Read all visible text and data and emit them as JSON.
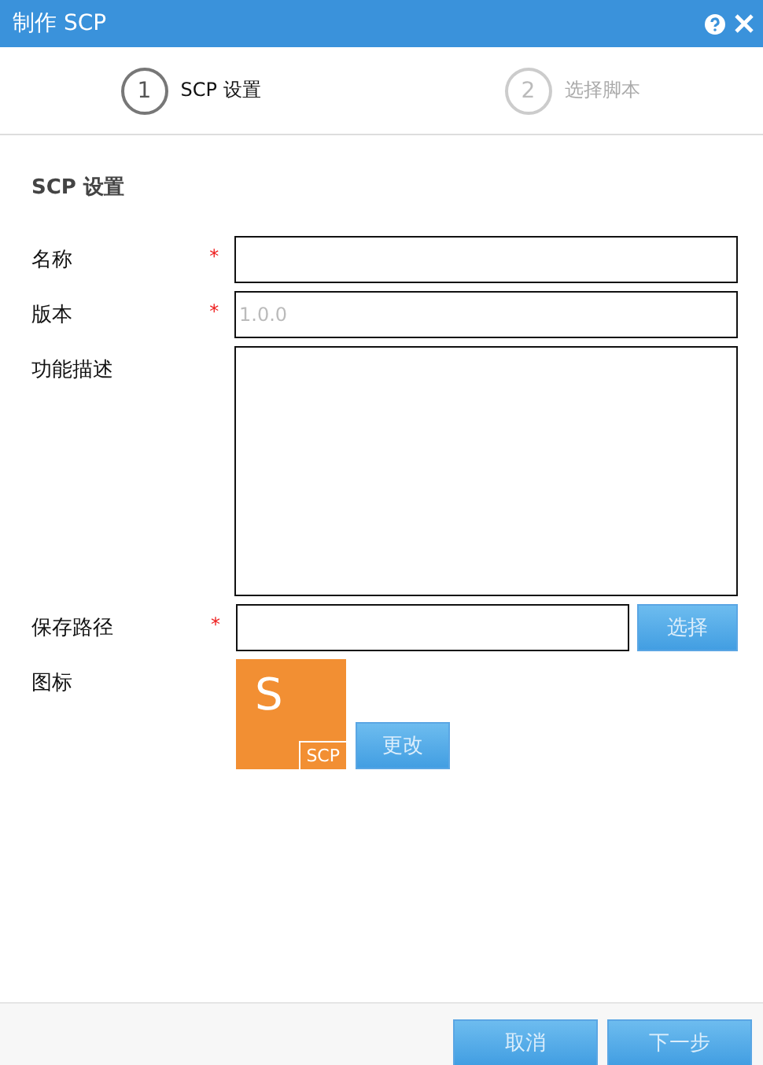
{
  "window": {
    "title": "制作 SCP"
  },
  "steps": [
    {
      "number": "1",
      "label": "SCP 设置",
      "selected": true
    },
    {
      "number": "2",
      "label": "选择脚本",
      "selected": false
    }
  ],
  "section_title": "SCP 设置",
  "fields": [
    {
      "kind": "text",
      "label": "名称",
      "mark": "*"
    },
    {
      "kind": "text",
      "label": "版本",
      "mark": "*",
      "placeholder": "1.0.0"
    },
    {
      "kind": "textarea",
      "label": "功能描述"
    },
    {
      "kind": "path",
      "label": "保存路径",
      "mark": "*",
      "button": "选择"
    },
    {
      "kind": "icon",
      "label": "图标",
      "icon_letter": "S",
      "icon_tag": "SCP",
      "button": "更改"
    }
  ],
  "buttons": [
    "取消",
    "下一步"
  ]
}
